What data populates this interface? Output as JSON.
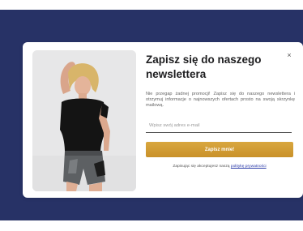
{
  "popup": {
    "title": "Zapisz się do naszego newslettera",
    "description": "Nie przegap żadnej promocji! Zapisz się do naszego newslettera i otrzymuj informacje o najnowszych ofertach prosto na swoją skrzynkę mailową.",
    "email_placeholder": "Wpisz swój adres e-mail",
    "submit_label": "Zapisz mnie!",
    "consent_text": "Zapisując się akceptujesz naszą ",
    "consent_link_label": "politykę prywatności",
    "close_label": "×"
  },
  "colors": {
    "backdrop": "#273266",
    "button": "#d09a34",
    "link": "#2a3aa8"
  }
}
